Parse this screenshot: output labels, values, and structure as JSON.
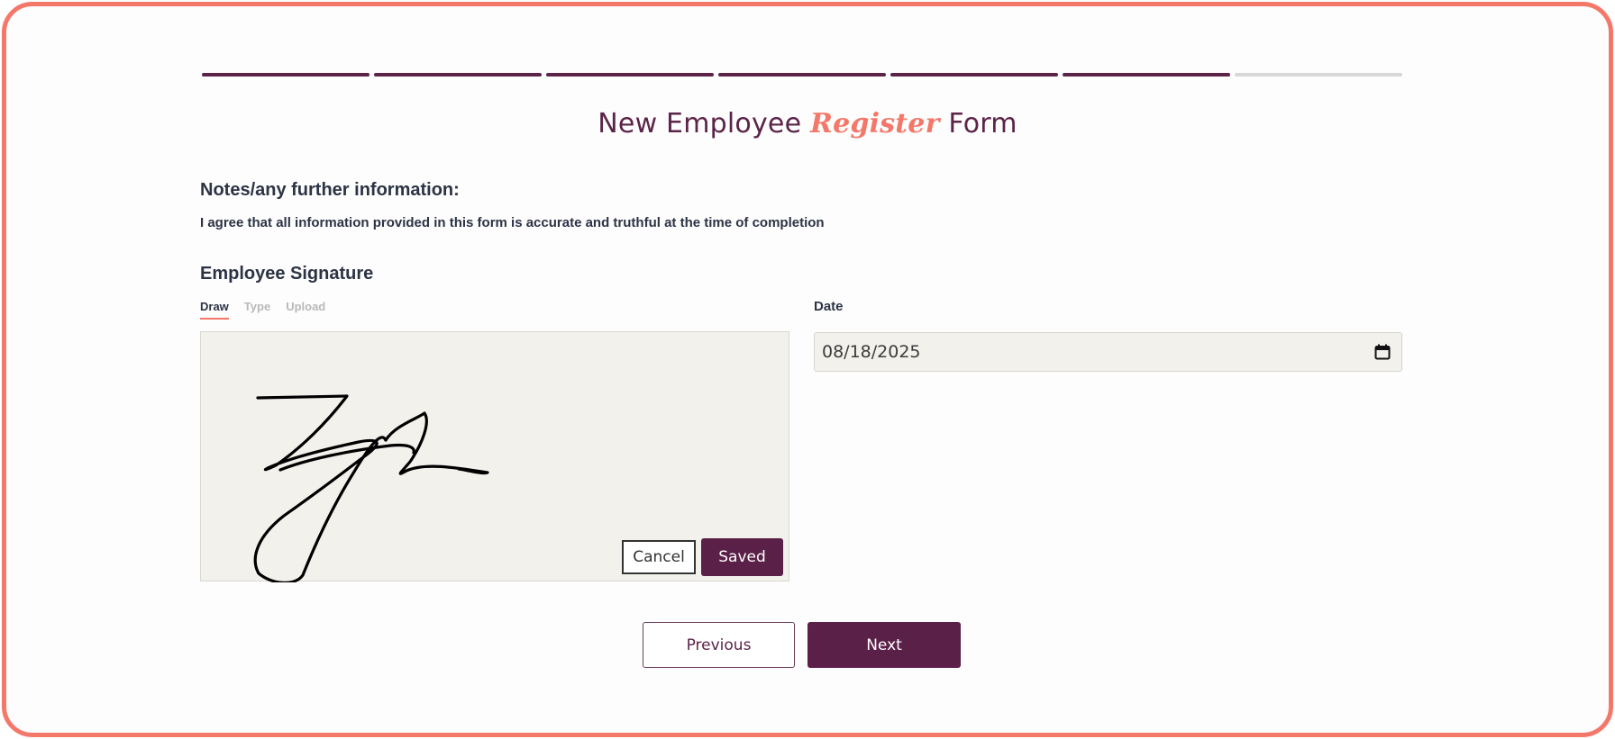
{
  "progress": {
    "completed_color": "#5b2448",
    "pending_color": "#d8d8d8",
    "steps": [
      {
        "status": "done"
      },
      {
        "status": "done"
      },
      {
        "status": "done"
      },
      {
        "status": "done"
      },
      {
        "status": "done"
      },
      {
        "status": "done"
      },
      {
        "status": "pending"
      }
    ]
  },
  "title": {
    "before": "New Employee ",
    "accent": "Register",
    "after": " Form"
  },
  "notes": {
    "heading": "Notes/any further information:",
    "agreement": "I agree that all information provided in this form is accurate and truthful at the time of completion"
  },
  "signature": {
    "heading": "Employee Signature",
    "tabs": [
      {
        "label": "Draw",
        "active": true
      },
      {
        "label": "Type",
        "active": false
      },
      {
        "label": "Upload",
        "active": false
      }
    ],
    "cancel_label": "Cancel",
    "saved_label": "Saved"
  },
  "date": {
    "label": "Date",
    "value": "08/18/2025",
    "icon": "calendar-icon"
  },
  "nav": {
    "previous_label": "Previous",
    "next_label": "Next"
  },
  "colors": {
    "brand": "#5b2048",
    "accent": "#f4786a"
  }
}
